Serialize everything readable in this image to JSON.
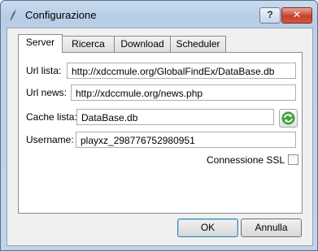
{
  "window": {
    "title": "Configurazione"
  },
  "titlebar": {
    "help_label": "?",
    "close_label": "✕"
  },
  "tabs": [
    {
      "label": "Server",
      "active": true
    },
    {
      "label": "Ricerca",
      "active": false
    },
    {
      "label": "Download",
      "active": false
    },
    {
      "label": "Scheduler",
      "active": false
    }
  ],
  "server": {
    "url_lista_label": "Url lista:",
    "url_lista_value": "http://xdccmule.org/GlobalFindEx/DataBase.db",
    "url_news_label": "Url news:",
    "url_news_value": "http://xdccmule.org/news.php",
    "cache_lista_label": "Cache lista:",
    "cache_lista_value": "DataBase.db",
    "username_label": "Username:",
    "username_value": "playxz_298776752980951",
    "ssl_label": "Connessione SSL",
    "ssl_checked": false
  },
  "buttons": {
    "ok_label": "OK",
    "cancel_label": "Annulla"
  },
  "icons": {
    "app": "feather-icon",
    "refresh": "refresh-icon"
  }
}
